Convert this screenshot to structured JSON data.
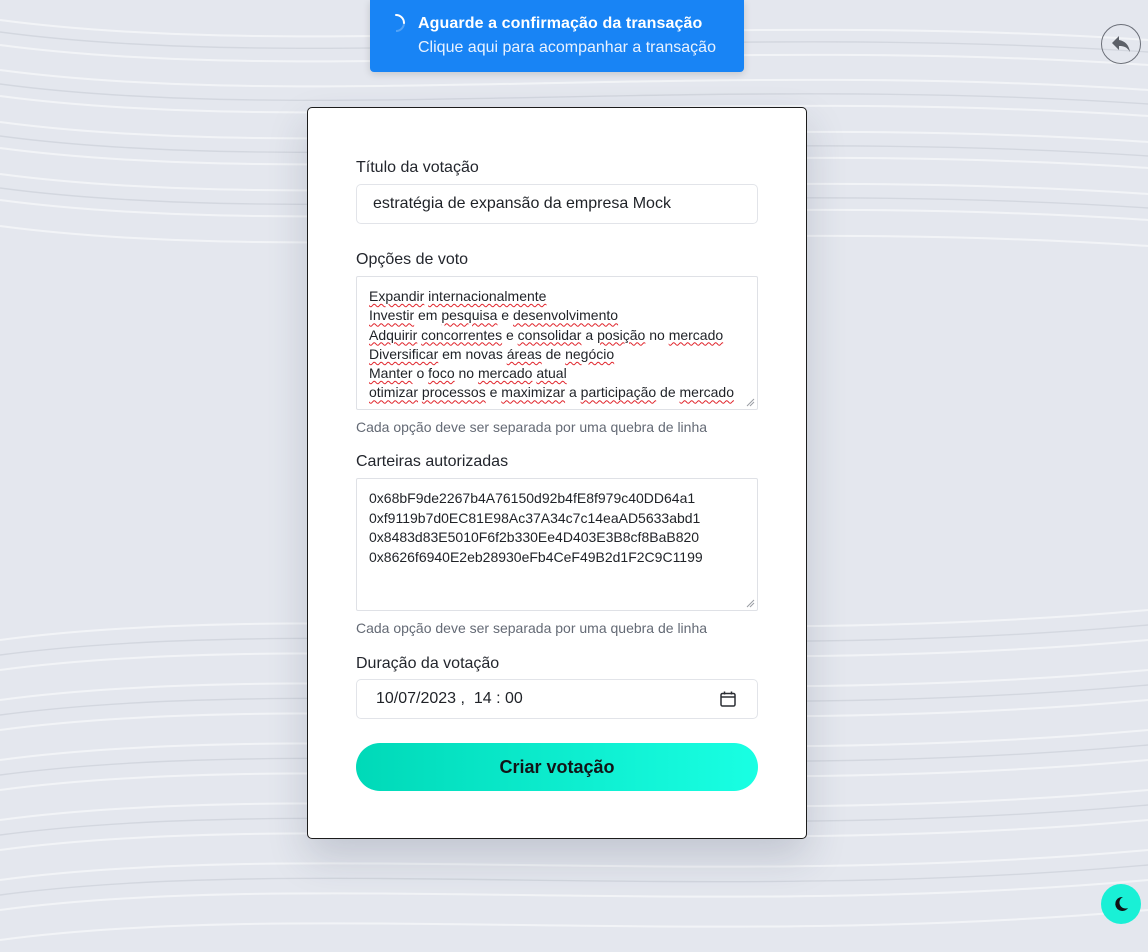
{
  "toast": {
    "title": "Aguarde a confirmação da transação",
    "subtitle": "Clique aqui para acompanhar a transação",
    "color": "#1884f5",
    "icon": "loading-spinner-icon"
  },
  "back_button": {
    "icon": "back-arrow-icon"
  },
  "form": {
    "title_label": "Título da votação",
    "title_value": "estratégia de expansão da empresa Mock",
    "options_label": "Opções de voto",
    "options_lines": [
      "Expandir internacionalmente",
      "Investir em pesquisa e desenvolvimento",
      "Adquirir concorrentes e consolidar a posição no mercado",
      "Diversificar em novas áreas de negócio",
      "Manter o foco no mercado atual",
      "otimizar processos e maximizar a participação de mercado"
    ],
    "options_hint": "Cada opção deve ser separada por uma quebra de linha",
    "wallets_label": "Carteiras autorizadas",
    "wallets": [
      "0x68bF9de2267b4A76150d92b4fE8f979c40DD64a1",
      "0xf9119b7d0EC81E98Ac37A34c7c14eaAD5633abd1",
      "0x8483d83E5010F6f2b330Ee4D403E3B8cf8BaB820",
      "0x8626f6940E2eb28930eFb4CeF49B2d1F2C9C1199"
    ],
    "wallets_hint": "Cada opção deve ser separada por uma quebra de linha",
    "duration_label": "Duração da votação",
    "duration_value": "10/07/2023 ,  14 : 00",
    "submit_label": "Criar votação",
    "accent_gradient": [
      "#00d9b8",
      "#19ffe3"
    ]
  },
  "theme_button": {
    "icon": "moon-icon",
    "color": "#19f0d6"
  }
}
